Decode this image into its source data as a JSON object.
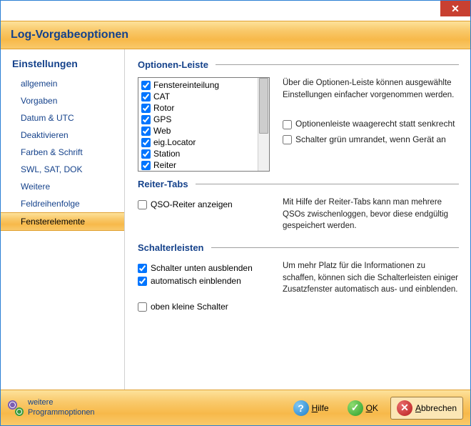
{
  "header": {
    "title": "Log-Vorgabeoptionen"
  },
  "sidebar": {
    "heading": "Einstellungen",
    "items": [
      {
        "label": "allgemein"
      },
      {
        "label": "Vorgaben"
      },
      {
        "label": "Datum & UTC"
      },
      {
        "label": "Deaktivieren"
      },
      {
        "label": "Farben & Schrift"
      },
      {
        "label": "SWL, SAT, DOK"
      },
      {
        "label": "Weitere"
      },
      {
        "label": "Feldreihenfolge"
      },
      {
        "label": "Fensterelemente"
      }
    ],
    "active_index": 8
  },
  "sections": {
    "optionen": {
      "title": "Optionen-Leiste",
      "list": [
        {
          "label": "Fenstereinteilung",
          "checked": true
        },
        {
          "label": "CAT",
          "checked": true
        },
        {
          "label": "Rotor",
          "checked": true
        },
        {
          "label": "GPS",
          "checked": true
        },
        {
          "label": "Web",
          "checked": true
        },
        {
          "label": "eig.Locator",
          "checked": true
        },
        {
          "label": "Station",
          "checked": true
        },
        {
          "label": "Reiter",
          "checked": true
        }
      ],
      "desc": "Über die Optionen-Leiste können ausgewählte Einstellungen einfacher vorgenommen werden.",
      "opt_horizontal": {
        "label": "Optionenleiste waagerecht statt senkrecht",
        "checked": false
      },
      "opt_green": {
        "label": "Schalter grün umrandet, wenn Gerät an",
        "checked": false
      }
    },
    "reiter": {
      "title": "Reiter-Tabs",
      "qso": {
        "label": "QSO-Reiter anzeigen",
        "checked": false
      },
      "desc": "Mit Hilfe der Reiter-Tabs kann man mehrere QSOs zwischenloggen, bevor diese endgültig gespeichert werden."
    },
    "schalter": {
      "title": "Schalterleisten",
      "unten": {
        "label": "Schalter unten ausblenden",
        "checked": true
      },
      "auto": {
        "label": "automatisch einblenden",
        "checked": true
      },
      "klein": {
        "label": "oben kleine Schalter",
        "checked": false
      },
      "desc": "Um mehr Platz für die Informationen zu schaffen, können sich die Schalterleisten einiger Zusatzfenster automatisch aus- und einblenden."
    }
  },
  "footer": {
    "more1": "weitere",
    "more2": "Programmoptionen",
    "help": "Hilfe",
    "ok": "OK",
    "cancel": "Abbrechen"
  }
}
